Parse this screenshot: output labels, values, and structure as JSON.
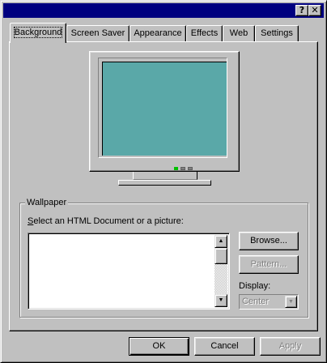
{
  "titlebar": {
    "help_label": "?",
    "close_label": "✕"
  },
  "tabs": [
    {
      "label": "Background",
      "active": true
    },
    {
      "label": "Screen Saver",
      "active": false
    },
    {
      "label": "Appearance",
      "active": false
    },
    {
      "label": "Effects",
      "active": false
    },
    {
      "label": "Web",
      "active": false
    },
    {
      "label": "Settings",
      "active": false
    }
  ],
  "preview": {
    "screen_color": "#5aa8a8"
  },
  "wallpaper": {
    "group_label": "Wallpaper",
    "select_label": "Select an HTML Document or a picture:",
    "items": [],
    "browse_label": "Browse...",
    "pattern_label": "Pattern...",
    "display_label": "Display:",
    "display_value": "Center"
  },
  "footer": {
    "ok_label": "OK",
    "cancel_label": "Cancel",
    "apply_label": "Apply"
  },
  "icons": {
    "scroll_up": "▲",
    "scroll_down": "▼",
    "dropdown": "▼"
  }
}
